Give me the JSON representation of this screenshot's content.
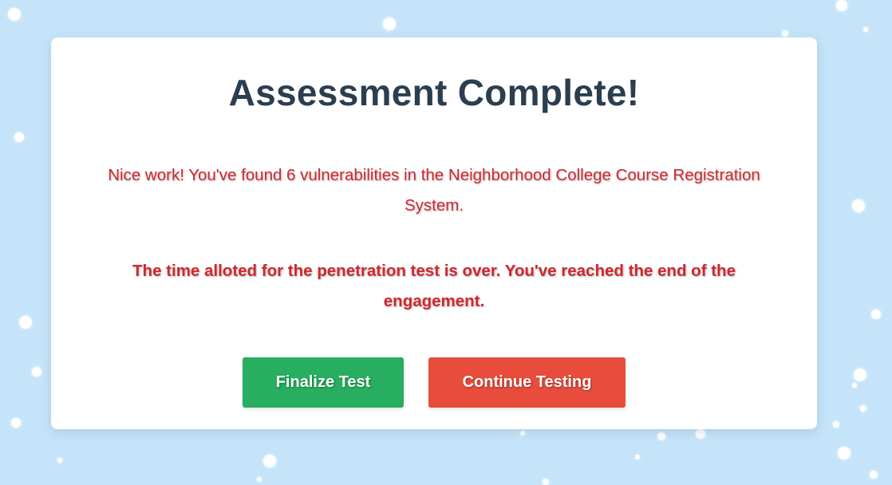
{
  "dialog": {
    "title": "Assessment Complete!",
    "message_found": "Nice work! You've found 6 vulnerabilities in the Neighborhood College Course Registration System.",
    "message_time_over": "The time alloted for the penetration test is over. You've reached the end of the engagement."
  },
  "actions": {
    "finalize_label": "Finalize Test",
    "continue_label": "Continue Testing"
  },
  "colors": {
    "background": "#c5e4f9",
    "title": "#2b3e50",
    "message": "#d0272f",
    "finalize_button": "#27ae60",
    "continue_button": "#e74c3c"
  }
}
